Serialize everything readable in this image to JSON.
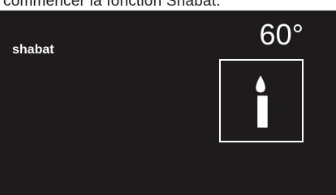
{
  "caption": "commencer la fonction Shabat.",
  "display": {
    "mode_label": "shabat",
    "temperature": "60°",
    "mode_icon": "candle-icon",
    "colors": {
      "background": "#1e1b1c",
      "foreground": "#ffffff"
    }
  }
}
